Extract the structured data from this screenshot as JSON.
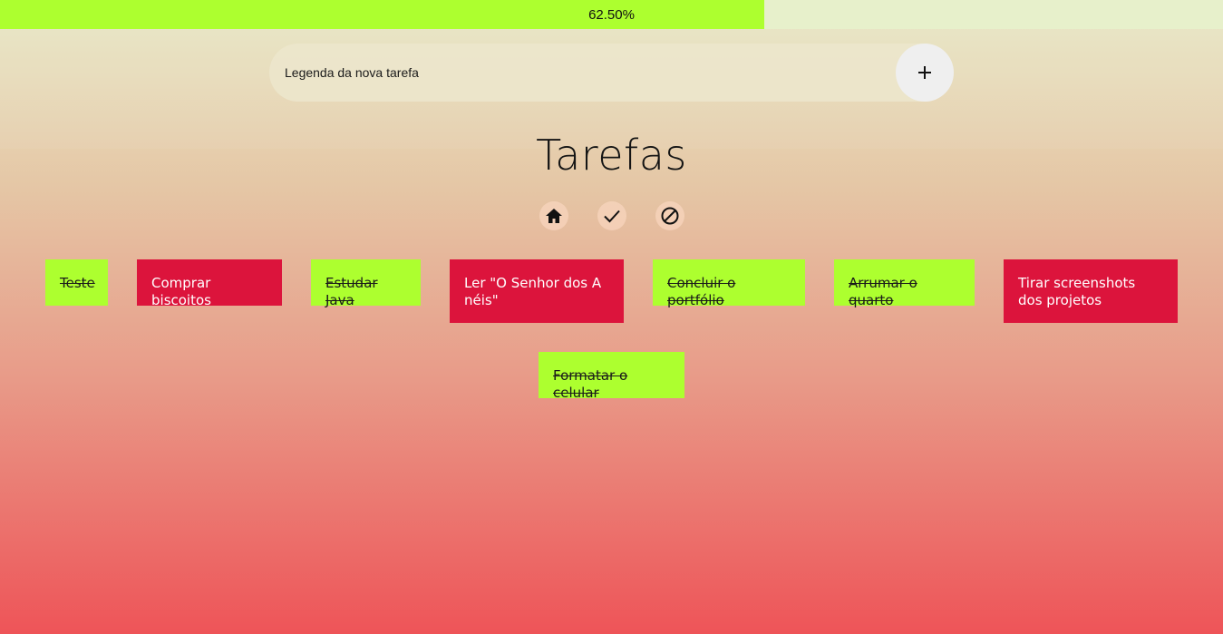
{
  "progress": {
    "label": "62.50%",
    "fraction": 0.625
  },
  "new_task": {
    "placeholder": "Legenda da nova tarefa",
    "add_icon": "plus-icon"
  },
  "title": "Tarefas",
  "filters": [
    {
      "name": "home-icon"
    },
    {
      "name": "check-icon"
    },
    {
      "name": "block-icon"
    }
  ],
  "tasks": [
    {
      "label": "Teste",
      "done": true
    },
    {
      "label": "Comprar biscoitos",
      "done": false
    },
    {
      "label": "Estudar Java",
      "done": true
    },
    {
      "label": "Ler \"O Senhor dos Anéis\"",
      "done": false
    },
    {
      "label": "Concluir o portfólio",
      "done": true
    },
    {
      "label": "Arrumar o quarto",
      "done": true
    },
    {
      "label": "Tirar screenshots dos projetos",
      "done": false
    },
    {
      "label": "Formatar o celular",
      "done": true
    }
  ],
  "colors": {
    "done": "#adff2f",
    "pending": "#dc143c"
  }
}
